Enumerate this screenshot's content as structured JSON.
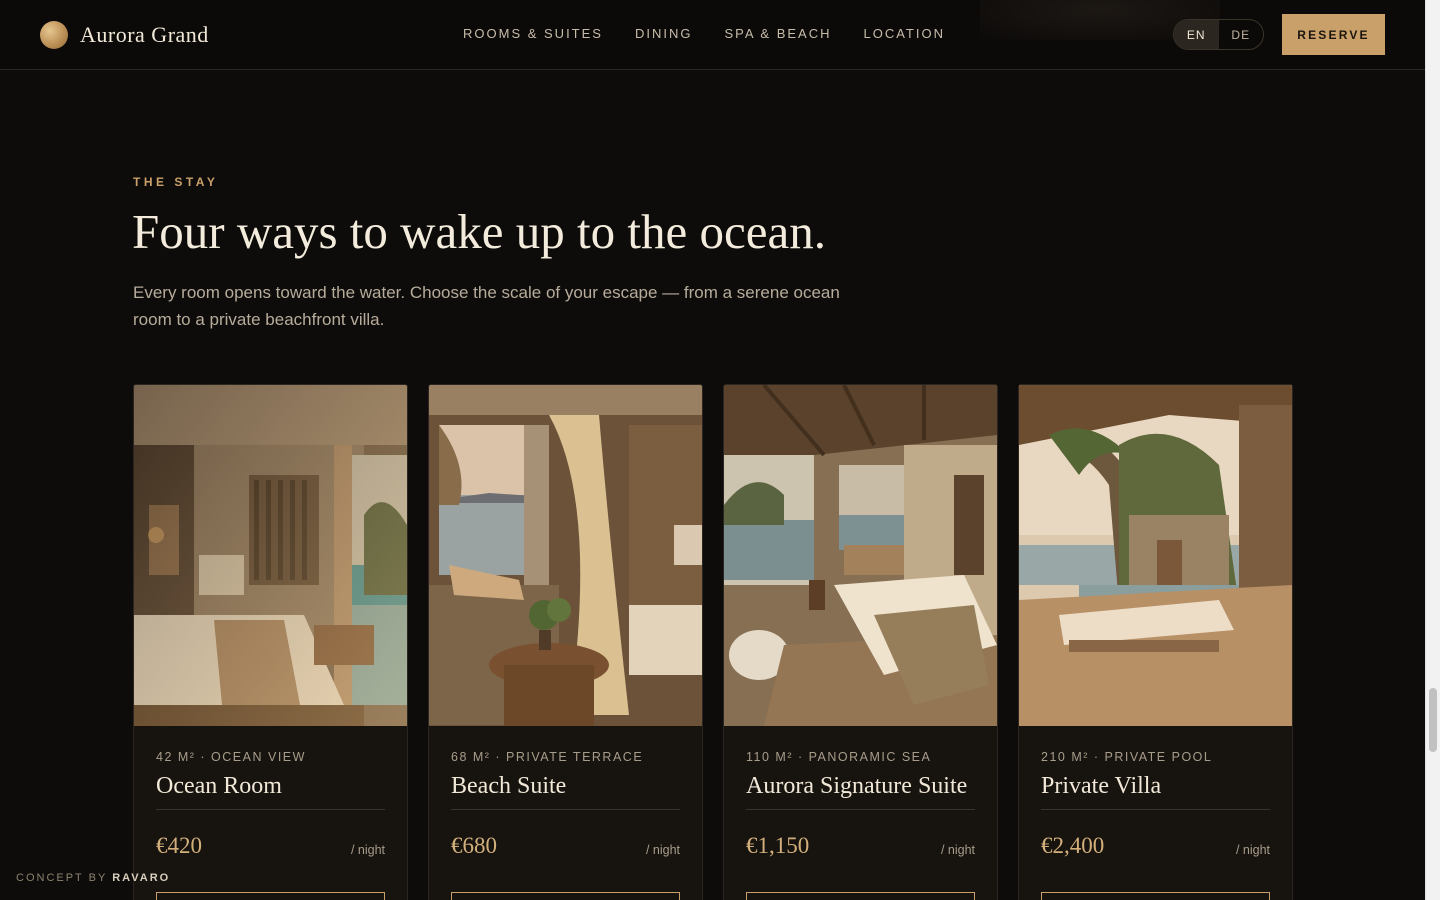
{
  "header": {
    "brand": "Aurora Grand",
    "nav": [
      "ROOMS & SUITES",
      "DINING",
      "SPA & BEACH",
      "LOCATION"
    ],
    "languages": [
      {
        "label": "EN",
        "active": true
      },
      {
        "label": "DE",
        "active": false
      }
    ],
    "reserve_label": "RESERVE"
  },
  "section": {
    "eyebrow": "THE STAY",
    "headline": "Four ways to wake up to the ocean.",
    "intro": "Every room opens toward the water. Choose the scale of your escape — from a serene ocean room to a private beachfront villa."
  },
  "rooms": [
    {
      "meta": "42 M² · OCEAN VIEW",
      "name": "Ocean Room",
      "price": "€420",
      "unit": "/ night"
    },
    {
      "meta": "68 M² · PRIVATE TERRACE",
      "name": "Beach Suite",
      "price": "€680",
      "unit": "/ night"
    },
    {
      "meta": "110 M² · PANORAMIC SEA",
      "name": "Aurora Signature Suite",
      "price": "€1,150",
      "unit": "/ night"
    },
    {
      "meta": "210 M² · PRIVATE POOL",
      "name": "Private Villa",
      "price": "€2,400",
      "unit": "/ night"
    }
  ],
  "credit": {
    "prefix": "CONCEPT BY",
    "name": "RAVARO"
  },
  "colors": {
    "background": "#0e0c0a",
    "accent": "#c9a06a",
    "card": "#17130f",
    "text": "#f1e8d8"
  }
}
